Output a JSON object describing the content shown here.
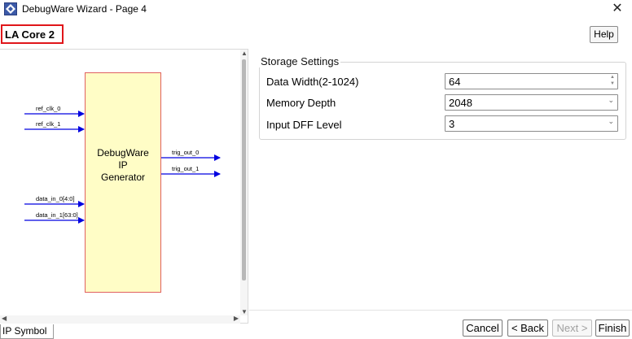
{
  "window": {
    "title": "DebugWare Wizard - Page 4",
    "close_glyph": "✕"
  },
  "header": {
    "core_title": "LA Core 2",
    "help_label": "Help"
  },
  "ip_symbol": {
    "tab_label": "IP Symbol",
    "block_label_lines": [
      "DebugWare",
      "IP",
      "Generator"
    ],
    "inputs": [
      "ref_clk_0",
      "ref_clk_1",
      "data_in_0[4:0]",
      "data_in_1[63:0]"
    ],
    "outputs": [
      "trig_out_0",
      "trig_out_1"
    ],
    "block_fill": "#fffdc6",
    "block_border": "#e06060",
    "wire_color": "#0000e0"
  },
  "storage": {
    "legend": "Storage Settings",
    "fields": [
      {
        "label": "Data Width(2-1024)",
        "value": "64",
        "control": "spinbox"
      },
      {
        "label": "Memory Depth",
        "value": "2048",
        "control": "dropdown"
      },
      {
        "label": "Input DFF Level",
        "value": "3",
        "control": "dropdown"
      }
    ]
  },
  "buttons": {
    "cancel": "Cancel",
    "back": "< Back",
    "next": "Next >",
    "finish": "Finish"
  },
  "icons": {
    "app": "debugware-app-icon",
    "close": "close-icon",
    "dropdown": "chevron-down-icon",
    "spin": "spin-arrows-icon"
  },
  "colors": {
    "highlight_border": "#e0161a"
  }
}
